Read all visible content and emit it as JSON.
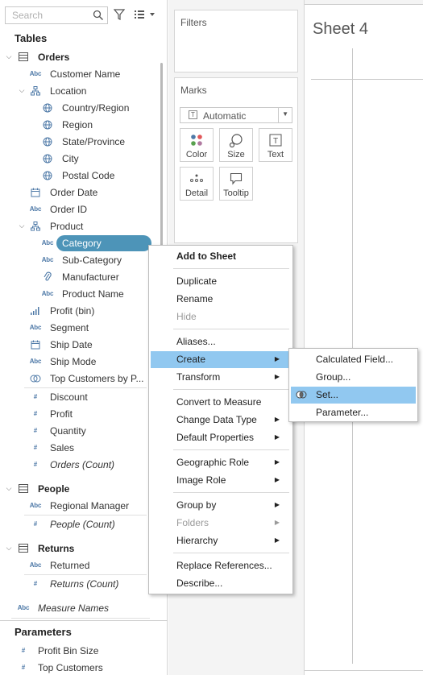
{
  "search": {
    "placeholder": "Search"
  },
  "data_pane": {
    "tables_title": "Tables",
    "orders": {
      "label": "Orders",
      "fields": {
        "customer_name": "Customer Name",
        "location": "Location",
        "country_region": "Country/Region",
        "region": "Region",
        "state_province": "State/Province",
        "city": "City",
        "postal_code": "Postal Code",
        "order_date": "Order Date",
        "order_id": "Order ID",
        "product": "Product",
        "category": "Category",
        "sub_category": "Sub-Category",
        "manufacturer": "Manufacturer",
        "product_name": "Product Name",
        "profit_bin": "Profit (bin)",
        "segment": "Segment",
        "ship_date": "Ship Date",
        "ship_mode": "Ship Mode",
        "top_customers_by_profit": "Top Customers by P...",
        "discount": "Discount",
        "profit": "Profit",
        "quantity": "Quantity",
        "sales": "Sales",
        "orders_count": "Orders (Count)"
      }
    },
    "people": {
      "label": "People",
      "fields": {
        "regional_manager": "Regional Manager",
        "people_count": "People (Count)"
      }
    },
    "returns": {
      "label": "Returns",
      "fields": {
        "returned": "Returned",
        "returns_count": "Returns (Count)"
      }
    },
    "measure_names": "Measure Names",
    "parameters_title": "Parameters",
    "parameters": {
      "profit_bin_size": "Profit Bin Size",
      "top_customers": "Top Customers"
    },
    "type_labels": {
      "abc": "Abc",
      "hash": "#"
    }
  },
  "shelves": {
    "filters_title": "Filters",
    "marks_title": "Marks",
    "mark_type": "Automatic",
    "mark_type_icon_glyph": "T",
    "buttons": {
      "color": "Color",
      "size": "Size",
      "text": "Text",
      "detail": "Detail",
      "tooltip": "Tooltip"
    }
  },
  "view": {
    "sheet_title": "Sheet 4"
  },
  "context_menu": {
    "add_to_sheet": "Add to Sheet",
    "duplicate": "Duplicate",
    "rename": "Rename",
    "hide": "Hide",
    "aliases": "Aliases...",
    "create": "Create",
    "transform": "Transform",
    "convert_to_measure": "Convert to Measure",
    "change_data_type": "Change Data Type",
    "default_properties": "Default Properties",
    "geographic_role": "Geographic Role",
    "image_role": "Image Role",
    "group_by": "Group by",
    "folders": "Folders",
    "hierarchy": "Hierarchy",
    "replace_references": "Replace References...",
    "describe": "Describe...",
    "submenu_arrow": "▶"
  },
  "create_submenu": {
    "calculated_field": "Calculated Field...",
    "group": "Group...",
    "set": "Set...",
    "parameter": "Parameter..."
  },
  "colors": {
    "selection_pill": "#4d94b8",
    "menu_highlight": "#91c8f0",
    "dimension_icon": "#4e79a7",
    "measure_icon": "#59a14f"
  }
}
